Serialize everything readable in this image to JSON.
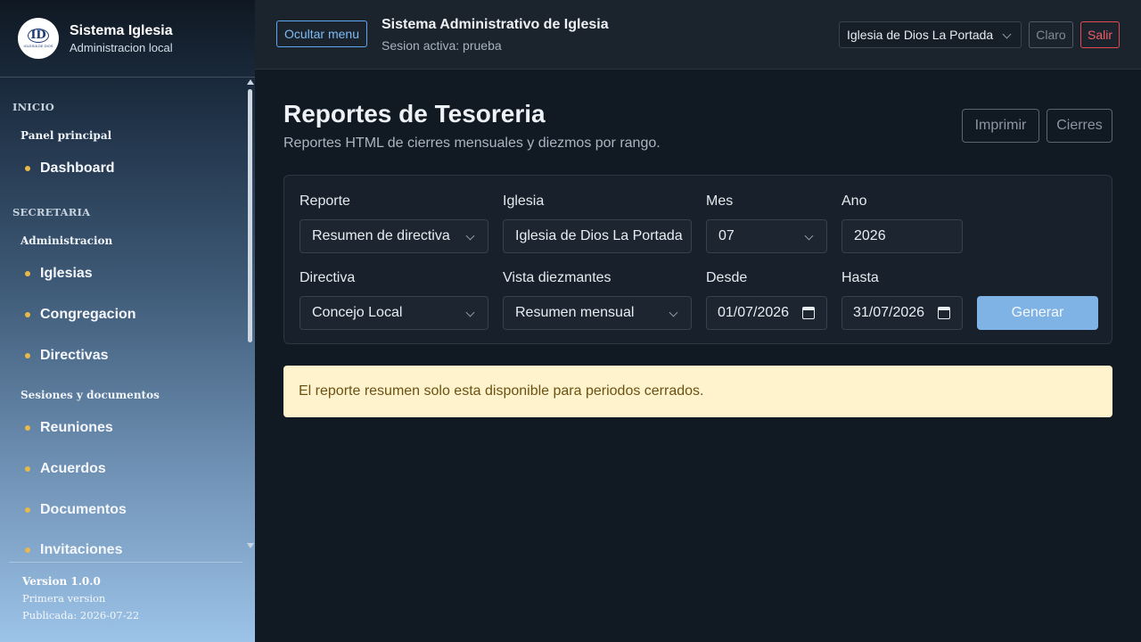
{
  "sidebar": {
    "brand_title": "Sistema Iglesia",
    "brand_subtitle": "Administracion local",
    "logo_mark": "ID",
    "logo_text": "IGLESIA DE DIOS",
    "sections": [
      {
        "title": "INICIO",
        "groups": [
          {
            "title": "Panel principal",
            "items": [
              "Dashboard"
            ]
          }
        ]
      },
      {
        "title": "SECRETARIA",
        "groups": [
          {
            "title": "Administracion",
            "items": [
              "Iglesias",
              "Congregacion",
              "Directivas"
            ]
          },
          {
            "title": "Sesiones y documentos",
            "items": [
              "Reuniones",
              "Acuerdos",
              "Documentos",
              "Invitaciones"
            ]
          }
        ]
      }
    ],
    "version": {
      "number": "Version 1.0.0",
      "note": "Primera version",
      "published": "Publicada: 2026-07-22"
    }
  },
  "topbar": {
    "toggle_label": "Ocultar menu",
    "title": "Sistema Administrativo de Iglesia",
    "session": "Sesion activa: prueba",
    "church_selected": "Iglesia de Dios La Portada",
    "theme_label": "Claro",
    "logout_label": "Salir"
  },
  "page": {
    "title": "Reportes de Tesoreria",
    "subtitle": "Reportes HTML de cierres mensuales y diezmos por rango.",
    "print_label": "Imprimir",
    "closures_label": "Cierres"
  },
  "form": {
    "reporte_label": "Reporte",
    "reporte_value": "Resumen de directiva",
    "iglesia_label": "Iglesia",
    "iglesia_value": "Iglesia de Dios La Portada",
    "mes_label": "Mes",
    "mes_value": "07",
    "ano_label": "Ano",
    "ano_value": "2026",
    "directiva_label": "Directiva",
    "directiva_value": "Concejo Local",
    "vista_label": "Vista diezmantes",
    "vista_value": "Resumen mensual",
    "desde_label": "Desde",
    "desde_value": "01/07/2026",
    "hasta_label": "Hasta",
    "hasta_value": "31/07/2026",
    "generate_label": "Generar"
  },
  "alert": {
    "message": "El reporte resumen solo esta disponible para periodos cerrados."
  },
  "colors": {
    "accent": "#7fb3e6",
    "danger": "#e34a55",
    "bullet": "#e8b84a",
    "warning_bg": "#fff3cd"
  }
}
